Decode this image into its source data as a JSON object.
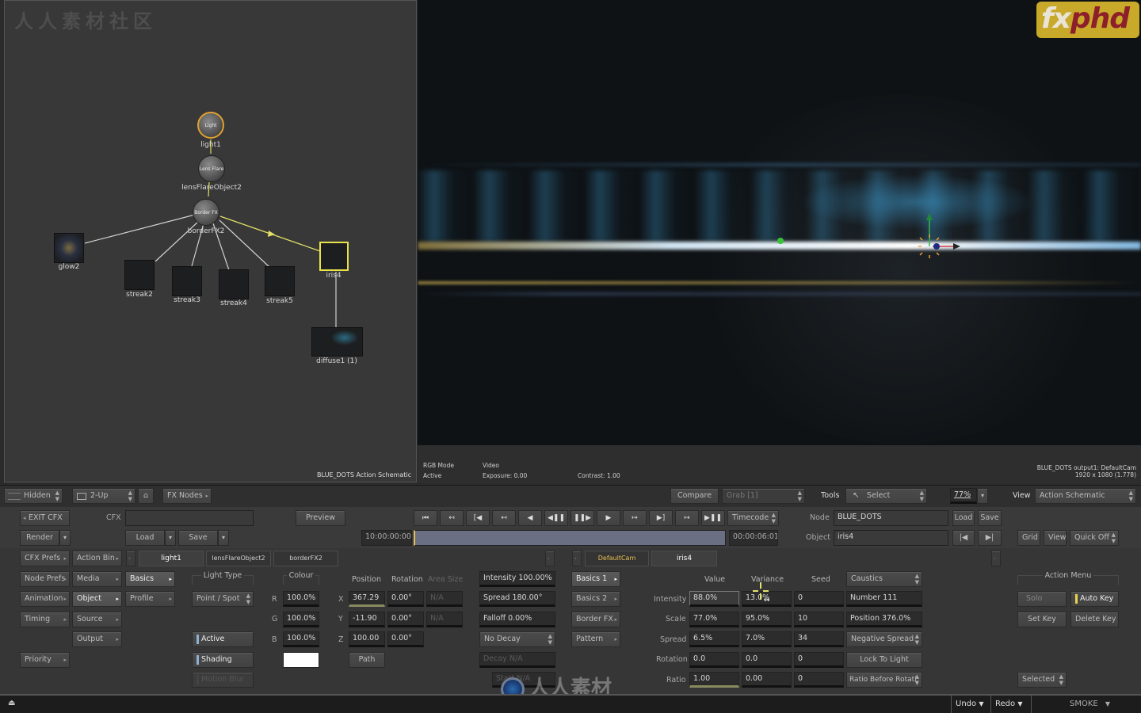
{
  "watermark": {
    "cn_text": "人人素材社区",
    "bottom_text": "人人素材",
    "logo": "fxphd",
    "logo_fx": "fx",
    "logo_phd": "phd"
  },
  "schematic": {
    "label": "BLUE_DOTS Action Schematic",
    "nodes": [
      {
        "id": "light1",
        "label": "light1",
        "icon_text": "Light",
        "kind": "circle",
        "selected": true
      },
      {
        "id": "lensFlareObject2",
        "label": "lensFlareObject2",
        "icon_text": "Lens Flare",
        "kind": "circle"
      },
      {
        "id": "borderFX2",
        "label": "borderFX2",
        "icon_text": "Border FX",
        "kind": "circle"
      },
      {
        "id": "glow2",
        "label": "glow2",
        "kind": "box"
      },
      {
        "id": "streak2",
        "label": "streak2",
        "kind": "box"
      },
      {
        "id": "streak3",
        "label": "streak3",
        "kind": "box"
      },
      {
        "id": "streak4",
        "label": "streak4",
        "kind": "box"
      },
      {
        "id": "streak5",
        "label": "streak5",
        "kind": "box"
      },
      {
        "id": "iris4",
        "label": "iris4",
        "kind": "box",
        "selected": true
      },
      {
        "id": "diffuse1",
        "label": "diffuse1 (1)",
        "kind": "box"
      }
    ]
  },
  "viewer": {
    "rgb_mode_label": "RGB Mode",
    "rgb_mode_value": "Active",
    "video_label": "Video",
    "exposure": "Exposure: 0.00",
    "contrast": "Contrast: 1.00",
    "output_name": "BLUE_DOTS output1: DefaultCam",
    "resolution": "1920 x 1080 (1.778)"
  },
  "topbar": {
    "hidden": "Hidden",
    "layout": "2-Up",
    "fx_nodes": "FX Nodes",
    "compare": "Compare",
    "grab": "Grab [1]",
    "tools_label": "Tools",
    "tools_value": "Select",
    "zoom": "77%",
    "view_label": "View",
    "view_value": "Action Schematic"
  },
  "controls": {
    "exit_cfx": "EXIT CFX",
    "cfx_label": "CFX",
    "cfx_value": "",
    "preview": "Preview",
    "render": "Render",
    "load": "Load",
    "save": "Save",
    "timecode_mode": "Timecode",
    "start_tc": "10:00:00:00",
    "end_tc": "00:00:06:01",
    "node_label": "Node",
    "node_value": "BLUE_DOTS",
    "object_label": "Object",
    "object_value": "iris4",
    "node_load": "Load",
    "node_save": "Save",
    "grid": "Grid",
    "view": "View",
    "quick": "Quick Off"
  },
  "transport": [
    "⏮",
    "↤",
    "[◀",
    "↤",
    "◀",
    "◀❚❚",
    "❚❚▶",
    "▶",
    "↦",
    "▶]",
    "↦",
    "▶❚❚"
  ],
  "left_menu": {
    "col1": [
      "CFX Prefs",
      "Node Prefs",
      "Animation",
      "Timing",
      "Priority"
    ],
    "col2": [
      "Action Bin",
      "Media",
      "Object",
      "Source",
      "Output"
    ],
    "col3": [
      "Basics",
      "Profile"
    ]
  },
  "tabs_left": [
    "light1",
    "lensFlareObject2",
    "borderFX2"
  ],
  "tabs_right": [
    "DefaultCam",
    "iris4"
  ],
  "light": {
    "light_type_header": "Light Type",
    "light_type": "Point / Spot",
    "active": "Active",
    "shading": "Shading",
    "motion_blur": "Motion Blur",
    "colour_header": "Colour",
    "r": "100.0%",
    "g": "100.0%",
    "b": "100.0%",
    "colour_swatch": "#ffffff"
  },
  "position": {
    "position_header": "Position",
    "rotation_header": "Rotation",
    "area_header": "Area Size",
    "x": "367.29",
    "y": "-11.90",
    "z": "100.00",
    "rx": "0.00°",
    "ry": "0.00°",
    "rz": "0.00°",
    "ax": "N/A",
    "ay": "N/A",
    "path": "Path"
  },
  "intensity": {
    "intensity": "Intensity 100.00%",
    "spread": "Spread 180.00°",
    "falloff": "Falloff 0.00%",
    "decay_mode": "No Decay",
    "decay": "Decay N/A",
    "start": "Start N/A"
  },
  "iris_menu": [
    "Basics 1",
    "Basics 2",
    "Border FX",
    "Pattern"
  ],
  "iris_table": {
    "headers": [
      "Value",
      "Variance",
      "Seed"
    ],
    "rows": [
      {
        "label": "Intensity",
        "value": "88.0%",
        "variance": "13.0%",
        "seed": "0"
      },
      {
        "label": "Scale",
        "value": "77.0%",
        "variance": "95.0%",
        "seed": "10"
      },
      {
        "label": "Spread",
        "value": "6.5%",
        "variance": "7.0%",
        "seed": "34"
      },
      {
        "label": "Rotation",
        "value": "0.0",
        "variance": "0.0",
        "seed": "0"
      },
      {
        "label": "Ratio",
        "value": "1.00",
        "variance": "0.00",
        "seed": "0"
      }
    ],
    "caustics": "Caustics",
    "number": "Number 111",
    "position": "Position 376.0%",
    "negative_spread": "Negative Spread",
    "lock_to_light": "Lock To Light",
    "ratio_before": "Ratio Before Rotati"
  },
  "action_menu": {
    "header": "Action Menu",
    "solo": "Solo",
    "auto_key": "Auto Key",
    "set_key": "Set Key",
    "delete_key": "Delete Key",
    "selected": "Selected"
  },
  "statusbar": {
    "undo": "Undo",
    "redo": "Redo",
    "app": "SMOKE"
  }
}
